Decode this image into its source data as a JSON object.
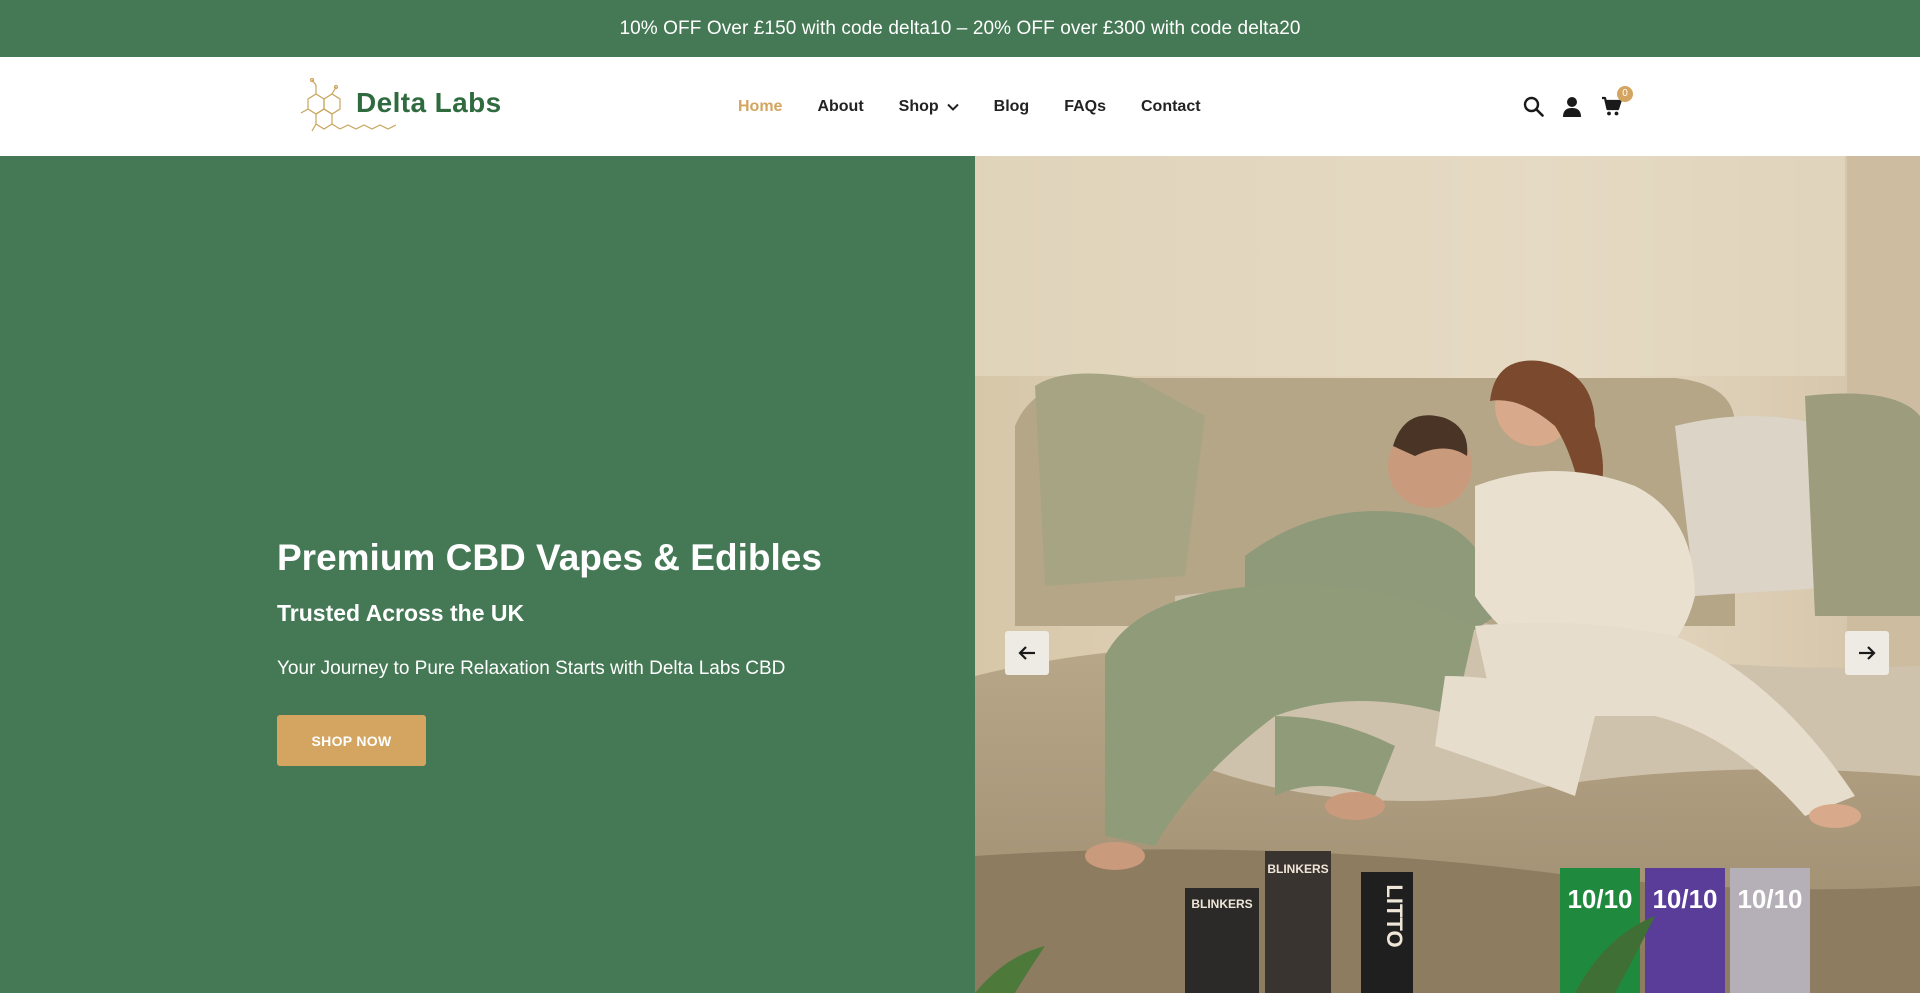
{
  "announcement": {
    "text": "10% OFF Over £150 with code delta10 – 20% OFF over £300 with code delta20"
  },
  "brand": {
    "name": "Delta Labs",
    "colors": {
      "green": "#457955",
      "gold": "#d3a560",
      "dark_green": "#2f6b3f"
    }
  },
  "nav": {
    "items": [
      {
        "label": "Home",
        "active": true
      },
      {
        "label": "About"
      },
      {
        "label": "Shop",
        "has_dropdown": true
      },
      {
        "label": "Blog"
      },
      {
        "label": "FAQs"
      },
      {
        "label": "Contact"
      }
    ]
  },
  "header_icons": {
    "search": "search-icon",
    "account": "user-icon",
    "cart": "cart-icon",
    "cart_count": "0"
  },
  "hero": {
    "title": "Premium CBD Vapes & Edibles",
    "subtitle": "Trusted Across the UK",
    "text": "Your Journey to Pure Relaxation Starts with Delta Labs CBD",
    "cta_label": "SHOP NOW",
    "prev_icon": "arrow-left-icon",
    "next_icon": "arrow-right-icon",
    "product_labels": [
      "BLINKERS",
      "BLINKERS",
      "LITTO",
      "10/10",
      "10/10",
      "10/10"
    ]
  }
}
